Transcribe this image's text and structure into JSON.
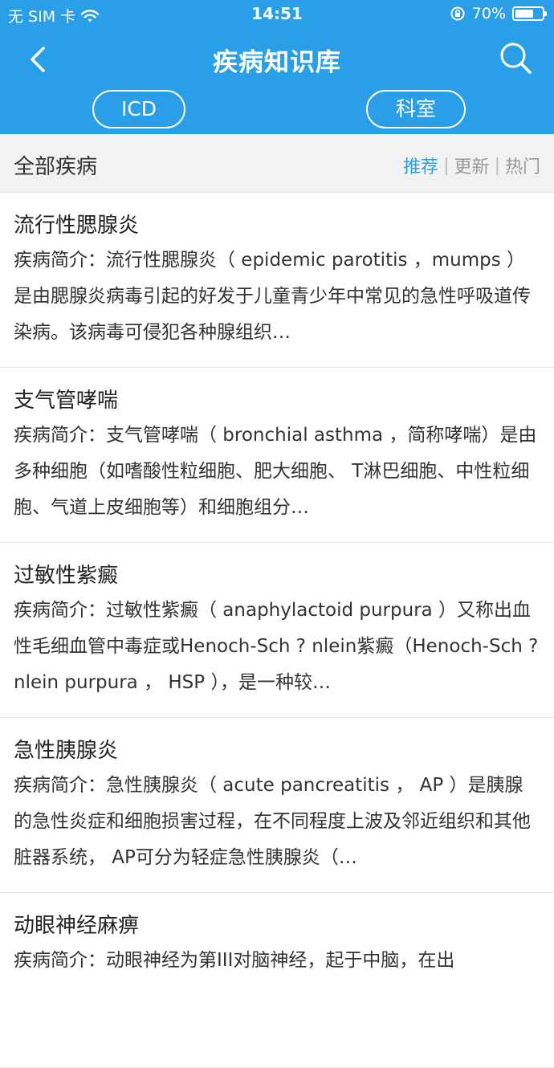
{
  "status": {
    "carrier": "无 SIM 卡",
    "time": "14:51",
    "battery": "70%",
    "battery_level": 0.7
  },
  "header": {
    "title": "疾病知识库",
    "tabs": [
      {
        "label": "ICD"
      },
      {
        "label": "科室"
      }
    ]
  },
  "filter": {
    "title": "全部疾病",
    "sort": [
      {
        "label": "推荐"
      },
      {
        "label": "更新"
      },
      {
        "label": "热门"
      }
    ],
    "separator": "|"
  },
  "items": [
    {
      "title": "流行性腮腺炎",
      "desc": "疾病简介：流行性腮腺炎（ epidemic parotitis ，mumps ）是由腮腺炎病毒引起的好发于儿童青少年中常见的急性呼吸道传染病。该病毒可侵犯各种腺组织…"
    },
    {
      "title": "支气管哮喘",
      "desc": "疾病简介：支气管哮喘（ bronchial asthma ，简称哮喘）是由多种细胞（如嗜酸性粒细胞、肥大细胞、 T淋巴细胞、中性粒细胞、气道上皮细胞等）和细胞组分…"
    },
    {
      "title": "过敏性紫癜",
      "desc": "疾病简介：过敏性紫癜（ anaphylactoid purpura ）又称出血性毛细血管中毒症或Henoch-Sch ? nlein紫癜（Henoch-Sch ? nlein purpura ， HSP ），是一种较…"
    },
    {
      "title": "急性胰腺炎",
      "desc": "疾病简介：急性胰腺炎（ acute pancreatitis ， AP ）是胰腺的急性炎症和细胞损害过程，在不同程度上波及邻近组织和其他脏器系统， AP可分为轻症急性胰腺炎（…"
    },
    {
      "title": "动眼神经麻痹",
      "desc": "疾病简介：动眼神经为第III对脑神经，起于中脑，在出"
    }
  ]
}
